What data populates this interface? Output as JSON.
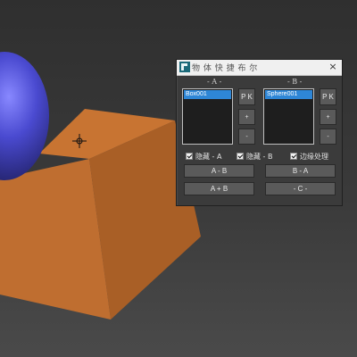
{
  "scene": {
    "objects": [
      "sphere",
      "box"
    ],
    "colors": {
      "sphere": "#4a4ad0",
      "box": "#b86a2e"
    }
  },
  "dialog": {
    "title": "物 体 快 捷 布 尔",
    "close_icon": "×",
    "col_a_label": "- A -",
    "col_b_label": "- B -",
    "list_a": [
      "Box001"
    ],
    "list_b": [
      "Sphere001"
    ],
    "pick_label": "P K",
    "plus_label": "+",
    "minus_label": "-",
    "hide_a_label": "隐藏 - A",
    "hide_b_label": "隐藏 - B",
    "edge_label": "边缘处理",
    "btn_a_minus_b": "A - B",
    "btn_b_minus_a": "B - A",
    "btn_a_plus_b": "A + B",
    "btn_c": "- C -",
    "accent": "#2e86d6"
  }
}
